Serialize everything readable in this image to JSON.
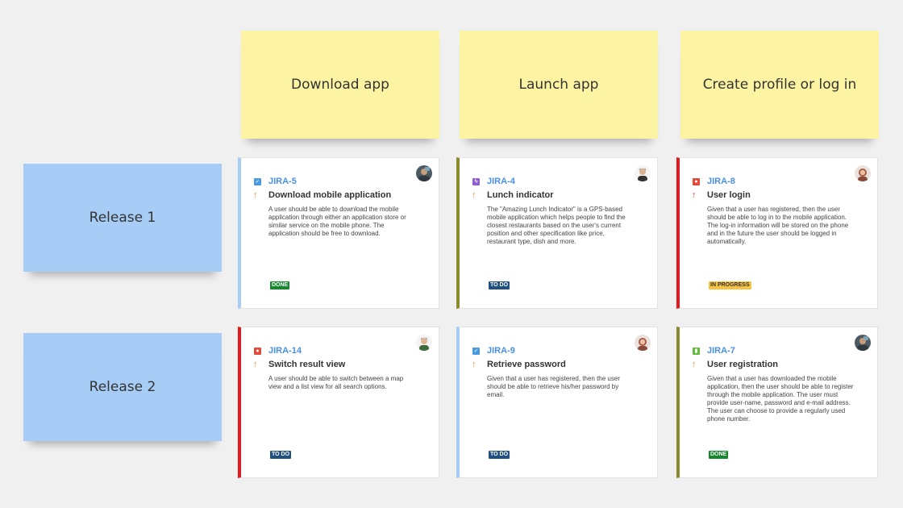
{
  "columns": [
    {
      "label": "Download app"
    },
    {
      "label": "Launch app"
    },
    {
      "label": "Create profile or log in"
    }
  ],
  "releases": [
    {
      "label": "Release 1"
    },
    {
      "label": "Release 2"
    }
  ],
  "cards": [
    {
      "key": "JIRA-5",
      "title": "Download mobile application",
      "description": "A user should be able to download the mobile application through either an application store or similar service on the mobile phone. The application should be free to download.",
      "status": "DONE",
      "status_color": "#14892c",
      "border_color": "#a7cdf6",
      "issue_type": "task-icon",
      "type_color": "#4a9ae1",
      "type_glyph": "✓",
      "priority_icon": "arrow-up-icon",
      "priority_color": "#f08c3a",
      "priority_glyph": "↑"
    },
    {
      "key": "JIRA-4",
      "title": "Lunch indicator",
      "description": "The \"Amazing Lunch Indicator\" is a GPS-based mobile application which helps people to find the closest restaurants based on the user's current position and other specification like price, restaurant type, dish and more.",
      "status": "TO DO",
      "status_color": "#205081",
      "border_color": "#8a8a2e",
      "issue_type": "epic-icon",
      "type_color": "#8f5fd6",
      "type_glyph": "ϟ",
      "priority_icon": "arrow-up-icon",
      "priority_color": "#f08c3a",
      "priority_glyph": "↑"
    },
    {
      "key": "JIRA-8",
      "title": "User login",
      "description": "Given that a user has registered, then the user should be able to log in to the mobile application. The log-in information will be stored on the phone and in the future the user should be logged in automatically.",
      "status": "IN PROGRESS",
      "status_color": "#f6c342",
      "status_text_color": "#333333",
      "border_color": "#e8171b",
      "issue_type": "bug-icon",
      "type_color": "#e5493a",
      "type_glyph": "●",
      "priority_icon": "arrow-up-icon",
      "priority_color": "#d04437",
      "priority_glyph": "↑"
    },
    {
      "key": "JIRA-14",
      "title": "Switch result view",
      "description": "A user should be able to switch between a map view and a list view for all search options.",
      "status": "TO DO",
      "status_color": "#205081",
      "border_color": "#e8171b",
      "issue_type": "bug-icon",
      "type_color": "#e5493a",
      "type_glyph": "●",
      "priority_icon": "arrow-up-icon",
      "priority_color": "#f08c3a",
      "priority_glyph": "↑"
    },
    {
      "key": "JIRA-9",
      "title": "Retrieve password",
      "description": "Given that a user has registered, then the user should be able to retrieve his/her password by email.",
      "status": "TO DO",
      "status_color": "#205081",
      "border_color": "#a7cdf6",
      "issue_type": "task-icon",
      "type_color": "#4a9ae1",
      "type_glyph": "✓",
      "priority_icon": "arrow-up-icon",
      "priority_color": "#f08c3a",
      "priority_glyph": "↑"
    },
    {
      "key": "JIRA-7",
      "title": "User registration",
      "description": "Given that a user has downloaded the mobile application, then the user should be able to register through the mobile application. The user must provide user-name, password and e-mail address. The user can choose to provide a regularly used phone number.",
      "status": "DONE",
      "status_color": "#14892c",
      "border_color": "#8a8a2e",
      "issue_type": "story-icon",
      "type_color": "#63ba3c",
      "type_glyph": "▮",
      "priority_icon": "arrow-up-icon",
      "priority_color": "#f08c3a",
      "priority_glyph": "↑"
    }
  ]
}
